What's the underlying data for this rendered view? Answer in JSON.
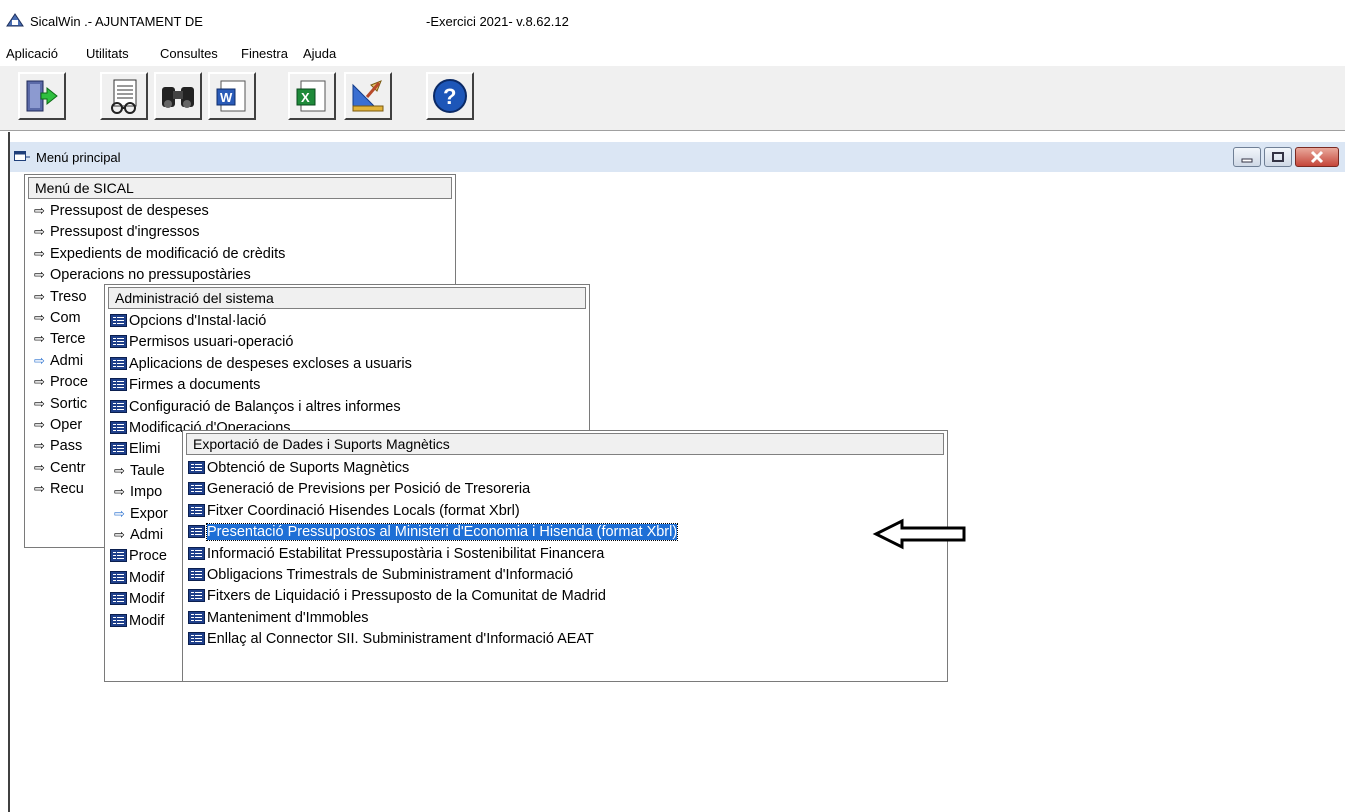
{
  "titlebar": {
    "app_title": "SicalWin .- AJUNTAMENT DE",
    "exercise": "-Exercici 2021- v.8.62.12"
  },
  "menubar": [
    "Aplicació",
    "Utilitats",
    "Consultes",
    "Finestra",
    "Ajuda"
  ],
  "toolbar": {
    "buttons": [
      "exit-icon",
      "report-icon",
      "binoculars-icon",
      "word-icon",
      "excel-icon",
      "ruler-icon",
      "help-icon"
    ]
  },
  "child_window": {
    "title": "Menú principal"
  },
  "menu_sical": {
    "header": "Menú de SICAL",
    "items": [
      "Pressupost de despeses",
      "Pressupost d'ingressos",
      "Expedients de modificació de crèdits",
      "Operacions no pressupostàries",
      "Treso",
      "Com",
      "Terce",
      "Admi",
      "Proce",
      "Sortic",
      "Oper",
      "Pass",
      "Centr",
      "Recu"
    ]
  },
  "menu_admin": {
    "header": "Administració del sistema",
    "items": [
      "Opcions d'Instal·lació",
      "Permisos usuari-operació",
      "Aplicacions de despeses excloses a usuaris",
      "Firmes a documents",
      "Configuració de Balanços i altres informes",
      "Modificació d'Operacions",
      "Elimi",
      "Taule",
      "Impo",
      "Expor",
      "Admi",
      "Proce",
      "Modif",
      "Modif",
      "Modif"
    ]
  },
  "menu_export": {
    "header": "Exportació de Dades i Suports Magnètics",
    "items": [
      "Obtenció  de  Suports  Magnètics",
      "Generació de Previsions per Posició de Tresoreria",
      "Fitxer Coordinació Hisendes Locals (format Xbrl)",
      "Presentació Pressupostos al Ministeri d'Economia i Hisenda (format Xbrl)",
      "Informació Estabilitat Pressupostària i Sostenibilitat Financera",
      "Obligacions Trimestrals de Subministrament d'Informació",
      "Fitxers de Liquidació i Pressuposto de la Comunitat de Madrid",
      "Manteniment d'Immobles",
      "Enllaç al Connector SII. Subministrament d'Informació AEAT"
    ],
    "selected_index": 3
  },
  "colors": {
    "highlight": "#1e6fd6",
    "child_title_bg": "#dbe6f4"
  }
}
